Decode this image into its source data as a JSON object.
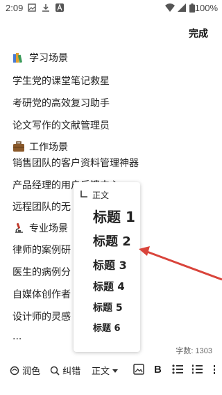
{
  "status": {
    "time": "2:09",
    "battery": "100%"
  },
  "header": {
    "done_label": "完成"
  },
  "doc": {
    "sections": [
      {
        "icon": "books-icon",
        "title": "学习场景",
        "items": [
          "学生党的课堂笔记救星",
          "考研党的高效复习助手",
          "论文写作的文献管理员"
        ]
      },
      {
        "icon": "briefcase-icon",
        "title": "工作场景",
        "items": [
          "销售团队的客户资料管理神器",
          "产品经理的用户反馈中心",
          "远程团队的无"
        ]
      },
      {
        "icon": "microscope-icon",
        "title": "专业场景",
        "items": [
          "律师的案例研",
          "医生的病例分",
          "自媒体创作者",
          "设计师的灵感"
        ]
      }
    ],
    "ellipsis": "...",
    "word_count": "字数: 1303"
  },
  "heading_menu": {
    "options": [
      "正文",
      "标题 1",
      "标题 2",
      "标题 3",
      "标题 4",
      "标题 5",
      "标题 6"
    ]
  },
  "toolbar": {
    "polish_label": "润色",
    "correct_label": "纠错",
    "style_label": "正文"
  },
  "colors": {
    "arrow": "#d9443b",
    "accent": "#222222"
  }
}
